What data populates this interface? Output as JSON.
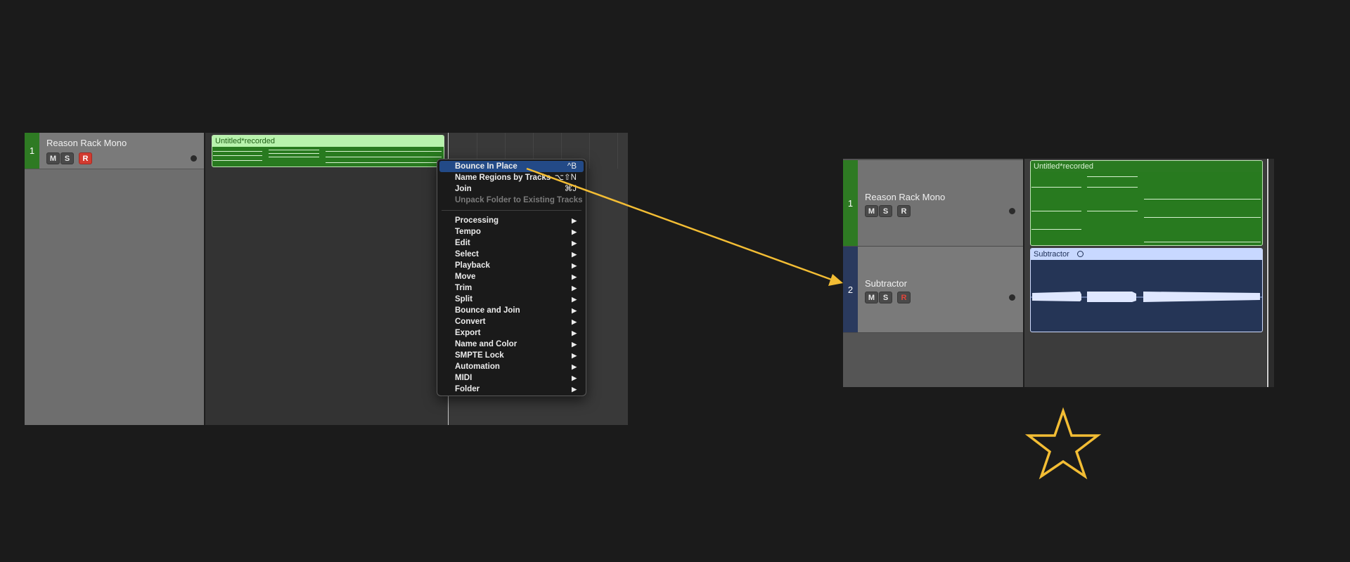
{
  "left_arrangement": {
    "track": {
      "number": "1",
      "name": "Reason Rack Mono",
      "mute": "M",
      "solo": "S",
      "record": "R"
    },
    "region": {
      "title": "Untitled*recorded"
    }
  },
  "context_menu": {
    "top_items": [
      {
        "label": "Bounce In Place",
        "shortcut": "^B"
      },
      {
        "label": "Name Regions by Tracks",
        "shortcut": "⌥⇧N"
      },
      {
        "label": "Join",
        "shortcut": "⌘J"
      },
      {
        "label": "Unpack Folder to Existing Tracks",
        "shortcut": ""
      }
    ],
    "submenus": [
      "Processing",
      "Tempo",
      "Edit",
      "Select",
      "Playback",
      "Move",
      "Trim",
      "Split",
      "Bounce and Join",
      "Convert",
      "Export",
      "Name and Color",
      "SMPTE Lock",
      "Automation",
      "MIDI",
      "Folder"
    ]
  },
  "right_arrangement": {
    "tracks": [
      {
        "number": "1",
        "name": "Reason Rack Mono",
        "mute": "M",
        "solo": "S",
        "record": "R",
        "color": "#2e7a23"
      },
      {
        "number": "2",
        "name": "Subtractor",
        "mute": "M",
        "solo": "S",
        "record": "R",
        "color": "#2a3a5e"
      }
    ],
    "regions": [
      {
        "title": "Untitled*recorded"
      },
      {
        "title": "Subtractor",
        "title_icon": "circle-icon"
      }
    ]
  },
  "annotation": {
    "arrow_color": "#f3bd34",
    "star_color": "#f3bd34"
  }
}
